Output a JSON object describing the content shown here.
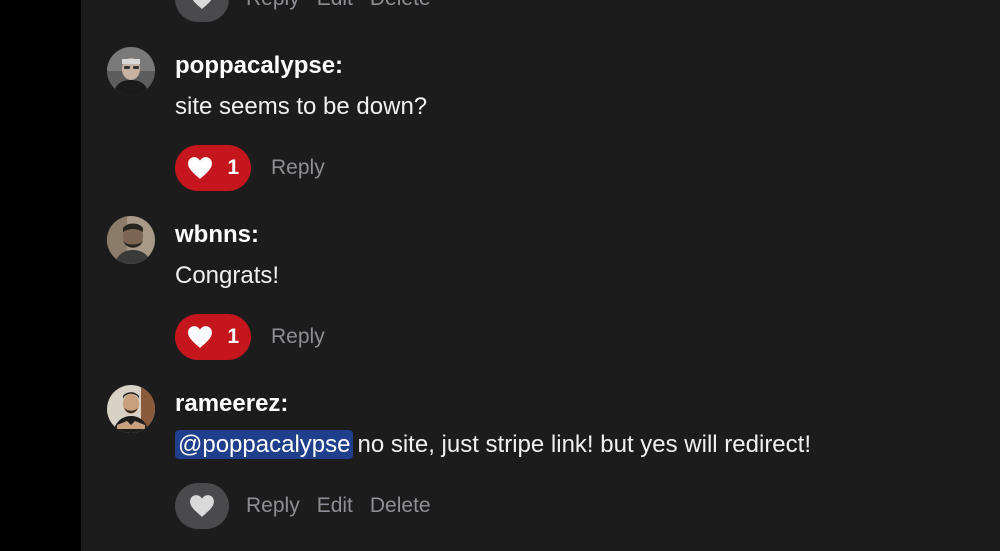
{
  "colors": {
    "background": "#1c1c1d",
    "like_active": "#c4161c",
    "like_inactive": "#4a4a4c",
    "mention_bg": "#1f3f8c",
    "muted_text": "#8e8e93"
  },
  "top_partial": {
    "reply_label": "Reply",
    "edit_label": "Edit",
    "delete_label": "Delete",
    "heart_icon": "heart-icon"
  },
  "comments": [
    {
      "username": "poppacalypse:",
      "text": "site seems to be down?",
      "likes": "1",
      "liked": true,
      "reply_label": "Reply"
    },
    {
      "username": "wbnns:",
      "text": "Congrats!",
      "likes": "1",
      "liked": true,
      "reply_label": "Reply"
    },
    {
      "username": "rameerez:",
      "mention": "@poppacalypse",
      "text": "no site, just stripe link! but yes will redirect!",
      "liked": false,
      "reply_label": "Reply",
      "edit_label": "Edit",
      "delete_label": "Delete"
    }
  ]
}
